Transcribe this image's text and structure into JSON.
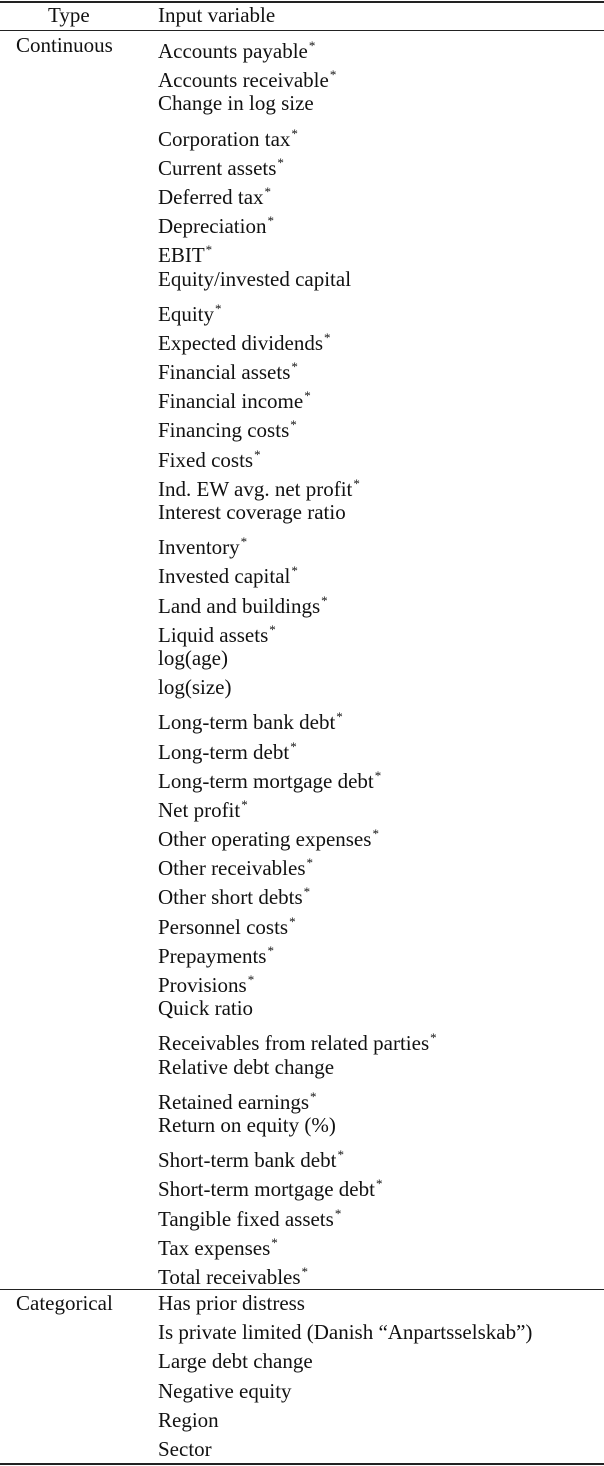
{
  "table": {
    "headers": {
      "type": "Type",
      "variable": "Input variable"
    },
    "groups": [
      {
        "type": "Continuous",
        "variables": [
          {
            "name": "Accounts payable",
            "starred": true
          },
          {
            "name": "Accounts receivable",
            "starred": true
          },
          {
            "name": "Change in log size",
            "starred": false
          },
          {
            "name": "Corporation tax",
            "starred": true
          },
          {
            "name": "Current assets",
            "starred": true
          },
          {
            "name": "Deferred tax",
            "starred": true
          },
          {
            "name": "Depreciation",
            "starred": true
          },
          {
            "name": "EBIT",
            "starred": true
          },
          {
            "name": "Equity/invested capital",
            "starred": false
          },
          {
            "name": "Equity",
            "starred": true
          },
          {
            "name": "Expected dividends",
            "starred": true
          },
          {
            "name": "Financial assets",
            "starred": true
          },
          {
            "name": "Financial income",
            "starred": true
          },
          {
            "name": "Financing costs",
            "starred": true
          },
          {
            "name": "Fixed costs",
            "starred": true
          },
          {
            "name": "Ind. EW avg. net profit",
            "starred": true
          },
          {
            "name": "Interest coverage ratio",
            "starred": false
          },
          {
            "name": "Inventory",
            "starred": true
          },
          {
            "name": "Invested capital",
            "starred": true
          },
          {
            "name": "Land and buildings",
            "starred": true
          },
          {
            "name": "Liquid assets",
            "starred": true
          },
          {
            "name": "log(age)",
            "starred": false
          },
          {
            "name": "log(size)",
            "starred": false
          },
          {
            "name": "Long-term bank debt",
            "starred": true
          },
          {
            "name": "Long-term debt",
            "starred": true
          },
          {
            "name": "Long-term mortgage debt",
            "starred": true
          },
          {
            "name": "Net profit",
            "starred": true
          },
          {
            "name": "Other operating expenses",
            "starred": true
          },
          {
            "name": "Other receivables",
            "starred": true
          },
          {
            "name": "Other short debts",
            "starred": true
          },
          {
            "name": "Personnel costs",
            "starred": true
          },
          {
            "name": "Prepayments",
            "starred": true
          },
          {
            "name": "Provisions",
            "starred": true
          },
          {
            "name": "Quick ratio",
            "starred": false
          },
          {
            "name": "Receivables from related parties",
            "starred": true
          },
          {
            "name": "Relative debt change",
            "starred": false
          },
          {
            "name": "Retained earnings",
            "starred": true
          },
          {
            "name": "Return on equity (%)",
            "starred": false
          },
          {
            "name": "Short-term bank debt",
            "starred": true
          },
          {
            "name": "Short-term mortgage debt",
            "starred": true
          },
          {
            "name": "Tangible fixed assets",
            "starred": true
          },
          {
            "name": "Tax expenses",
            "starred": true
          },
          {
            "name": "Total receivables",
            "starred": true
          }
        ]
      },
      {
        "type": "Categorical",
        "variables": [
          {
            "name": "Has prior distress",
            "starred": false
          },
          {
            "name": "Is private limited (Danish “Anpartsselskab”)",
            "starred": false
          },
          {
            "name": "Large debt change",
            "starred": false
          },
          {
            "name": "Negative equity",
            "starred": false
          },
          {
            "name": "Region",
            "starred": false
          },
          {
            "name": "Sector",
            "starred": false
          }
        ]
      }
    ],
    "star_symbol": "*"
  }
}
